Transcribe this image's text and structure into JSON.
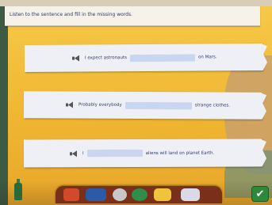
{
  "instruction": "Listen to the sentence and fill in the missing words.",
  "sentences": [
    {
      "before": "I expect astronauts",
      "after": "on Mars.",
      "blank_value": ""
    },
    {
      "before": "Probably everybody",
      "after": "strange clothes.",
      "blank_value": ""
    },
    {
      "before": "I",
      "after": "aliens will land on planet Earth.",
      "blank_value": ""
    }
  ],
  "icons": {
    "audio": "speaker-icon",
    "check": "check-icon"
  },
  "toolbar": {
    "items": [
      "home-icon",
      "calendar-icon",
      "timer-icon",
      "recycle-icon",
      "chart-icon",
      "scroll-icon"
    ]
  },
  "colors": {
    "background": "#f0b732",
    "paper": "#eef0f6",
    "blank": "#c9d6f2",
    "text": "#2f3a6b"
  }
}
